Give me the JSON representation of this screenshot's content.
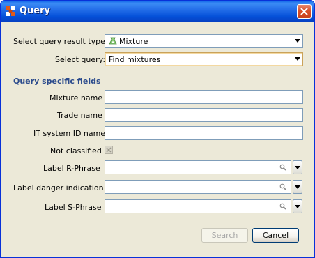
{
  "window": {
    "title": "Query",
    "app_icon": "app-puzzle-icon",
    "close_icon": "close-icon"
  },
  "form": {
    "result_type": {
      "label": "Select query result type:",
      "value": "Mixture",
      "value_icon": "mixture-icon"
    },
    "query": {
      "label": "Select query:",
      "value": "Find mixtures"
    }
  },
  "section": {
    "title": "Query specific fields"
  },
  "fields": {
    "mixture_name": {
      "label": "Mixture name",
      "value": ""
    },
    "trade_name": {
      "label": "Trade name",
      "value": ""
    },
    "it_system_id_name": {
      "label": "IT system ID name",
      "value": ""
    },
    "not_classified": {
      "label": "Not classified",
      "checked": false,
      "enabled": false
    },
    "label_r_phrase": {
      "label": "Label R-Phrase",
      "value": "",
      "icon": "search-icon"
    },
    "label_danger_indication": {
      "label": "Label danger indication",
      "value": "",
      "icon": "search-icon"
    },
    "label_s_phrase": {
      "label": "Label S-Phrase",
      "value": "",
      "icon": "search-icon"
    }
  },
  "buttons": {
    "search": {
      "label": "Search",
      "enabled": false
    },
    "cancel": {
      "label": "Cancel",
      "enabled": true
    }
  },
  "colors": {
    "titlebar": "#0551d9",
    "dialog_bg": "#ece9d8",
    "section_title": "#2a4a8c",
    "field_border": "#7f9db9",
    "close_button": "#d8502a"
  }
}
